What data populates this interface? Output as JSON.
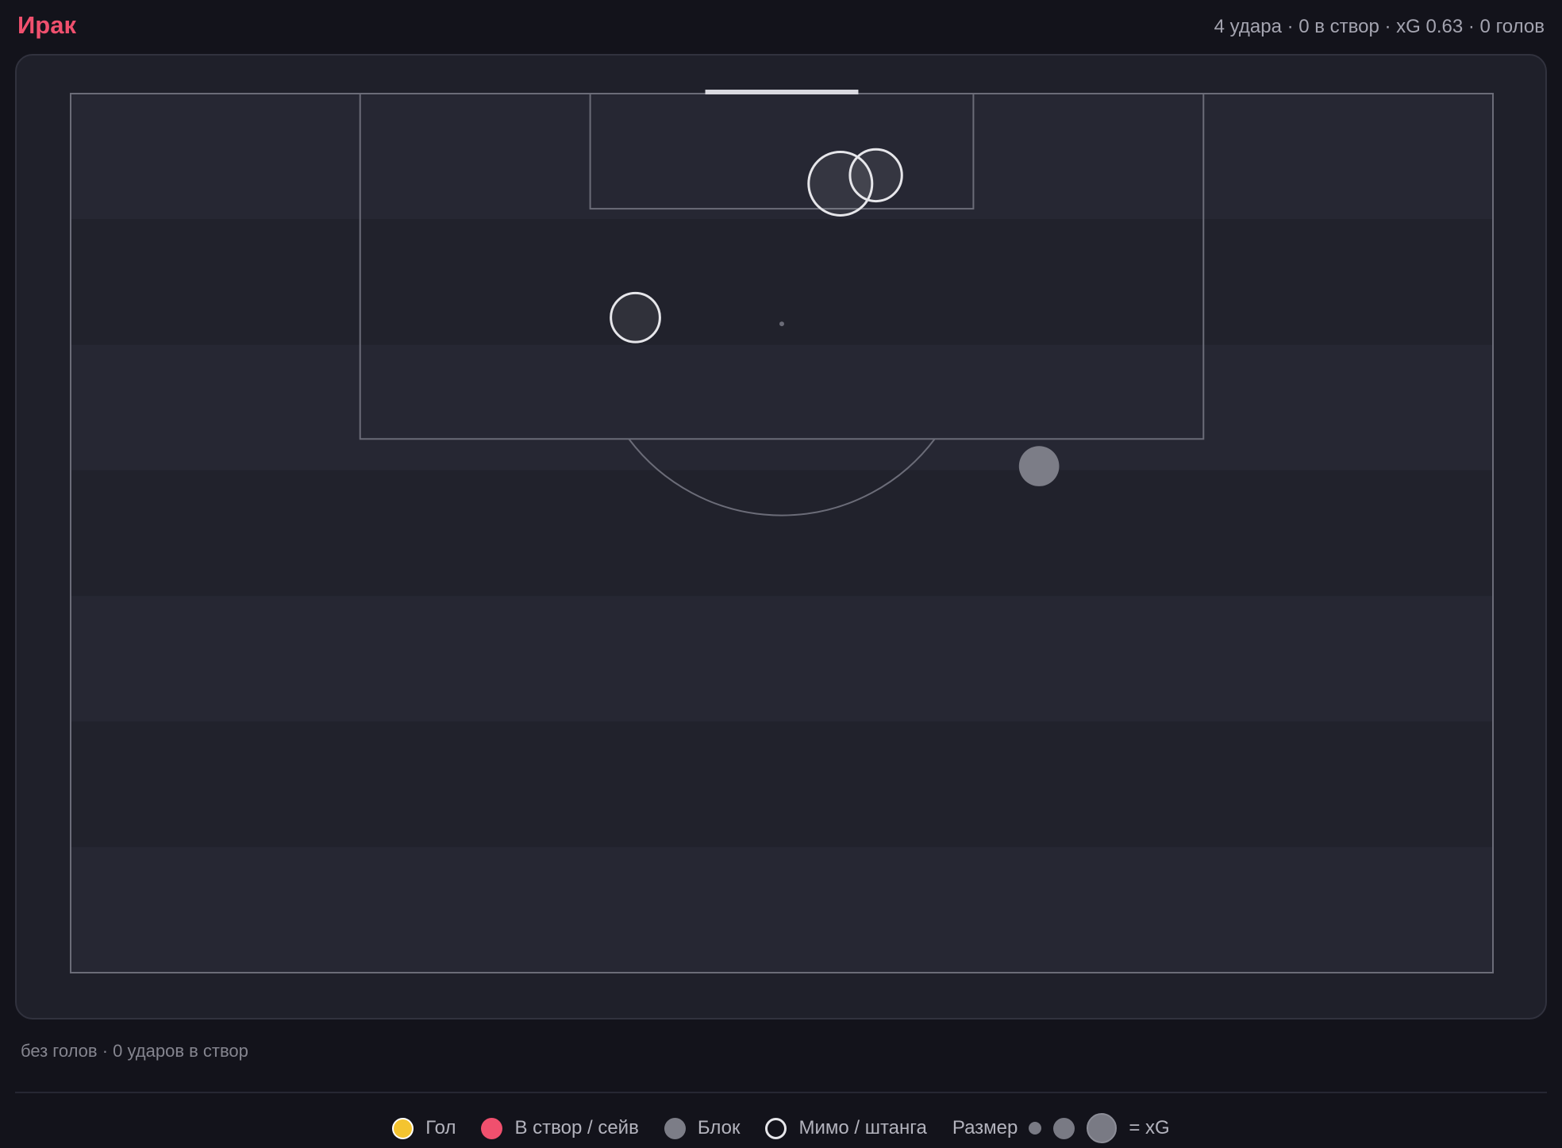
{
  "header": {
    "team": "Ирак",
    "summary": "4 удара · 0 в створ · xG 0.63 · 0 голов"
  },
  "note": "без голов · 0 ударов в створ",
  "legend": {
    "goal": "Гол",
    "on_target": "В створ / сейв",
    "blocked": "Блок",
    "off_target": "Мимо / штанга",
    "size_label": "Размер",
    "xg_label": "= xG"
  },
  "colors": {
    "team": "#f0506e",
    "goal": "#f4c430",
    "on_target": "#f0506e",
    "blocked": "#7c7d87",
    "off_target_stroke": "#e6e6ea"
  },
  "chart_data": {
    "type": "scatter",
    "pitch": "half-pitch, attacking goal at top",
    "axes": {
      "x_range": [
        0,
        68
      ],
      "y_range": [
        0,
        42
      ],
      "x_meaning": "metres across the pitch width",
      "y_meaning": "metres from the goal line"
    },
    "marker_size": "xG",
    "shots": [
      {
        "x": 36.8,
        "y": 4.3,
        "outcome": "off_target",
        "xg": 0.22
      },
      {
        "x": 38.5,
        "y": 3.9,
        "outcome": "off_target",
        "xg": 0.12
      },
      {
        "x": 27.0,
        "y": 10.7,
        "outcome": "off_target",
        "xg": 0.1
      },
      {
        "x": 46.3,
        "y": 17.8,
        "outcome": "blocked",
        "xg": 0.05
      }
    ]
  }
}
